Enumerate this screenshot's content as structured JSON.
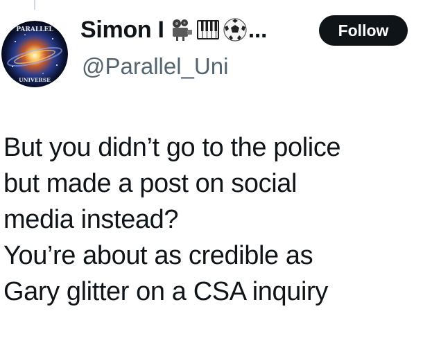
{
  "author": {
    "display_name": "Simon I",
    "name_emojis": [
      "film-projector-emoji",
      "piano-keys-emoji",
      "soccer-ball-emoji"
    ],
    "name_truncation": "...",
    "handle": "@Parallel_Uni",
    "avatar_text_top": "PARALLEL",
    "avatar_text_bottom": "UNIVERSE"
  },
  "actions": {
    "follow_label": "Follow"
  },
  "post": {
    "lines": [
      "But you didn’t go to the police",
      "but made a post on social",
      "media instead?",
      "You’re about as credible as",
      "Gary glitter on a CSA inquiry"
    ]
  },
  "colors": {
    "text": "#0f1419",
    "secondary_text": "#536471",
    "follow_bg": "#0f1419",
    "follow_text": "#ffffff"
  }
}
